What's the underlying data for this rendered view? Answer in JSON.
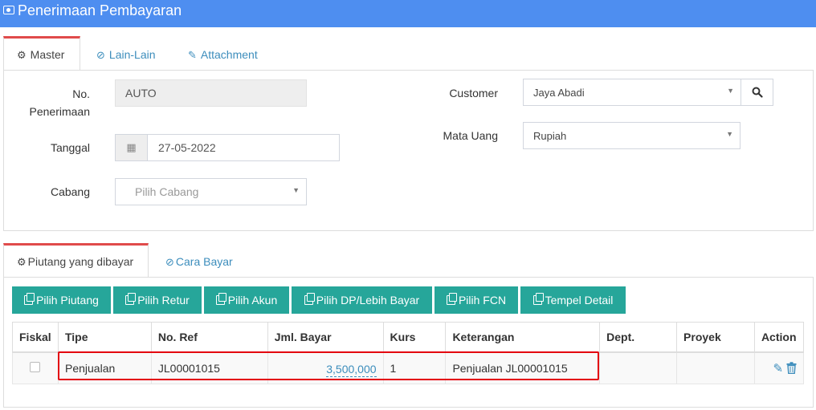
{
  "header": {
    "title": "Penerimaan Pembayaran",
    "icon": "money-icon"
  },
  "top_tabs": [
    {
      "label": "Master",
      "icon": "cogs-icon"
    },
    {
      "label": "Lain-Lain",
      "icon": "check-circle-icon"
    },
    {
      "label": "Attachment",
      "icon": "paperclip-icon"
    }
  ],
  "form": {
    "no_penerimaan_label": "No. Penerimaan",
    "no_penerimaan_value": "AUTO",
    "tanggal_label": "Tanggal",
    "tanggal_value": "27-05-2022",
    "cabang_label": "Cabang",
    "cabang_placeholder": "Pilih Cabang",
    "customer_label": "Customer",
    "customer_value": "Jaya Abadi",
    "mata_uang_label": "Mata Uang",
    "mata_uang_value": "Rupiah"
  },
  "detail_tabs": [
    {
      "label": "Piutang yang dibayar",
      "icon": "cogs-icon"
    },
    {
      "label": "Cara Bayar",
      "icon": "check-circle-icon"
    }
  ],
  "buttons": {
    "pilih_piutang": "Pilih Piutang",
    "pilih_retur": "Pilih Retur",
    "pilih_akun": "Pilih Akun",
    "pilih_dp": "Pilih DP/Lebih Bayar",
    "pilih_fcn": "Pilih FCN",
    "tempel_detail": "Tempel Detail"
  },
  "table": {
    "columns": [
      "Fiskal",
      "Tipe",
      "No. Ref",
      "Jml. Bayar",
      "Kurs",
      "Keterangan",
      "Dept.",
      "Proyek",
      "Action"
    ],
    "rows": [
      {
        "fiskal": "",
        "tipe": "Penjualan",
        "no_ref": "JL00001015",
        "jml_bayar": "3,500,000",
        "kurs": "1",
        "keterangan": "Penjualan JL00001015",
        "dept": "",
        "proyek": ""
      }
    ]
  },
  "colors": {
    "header_bg": "#4e8ef0",
    "button_bg": "#26a69a",
    "tab_active_border": "#e04b4b",
    "highlight": "#e3000f",
    "link": "#3c8dbc"
  }
}
